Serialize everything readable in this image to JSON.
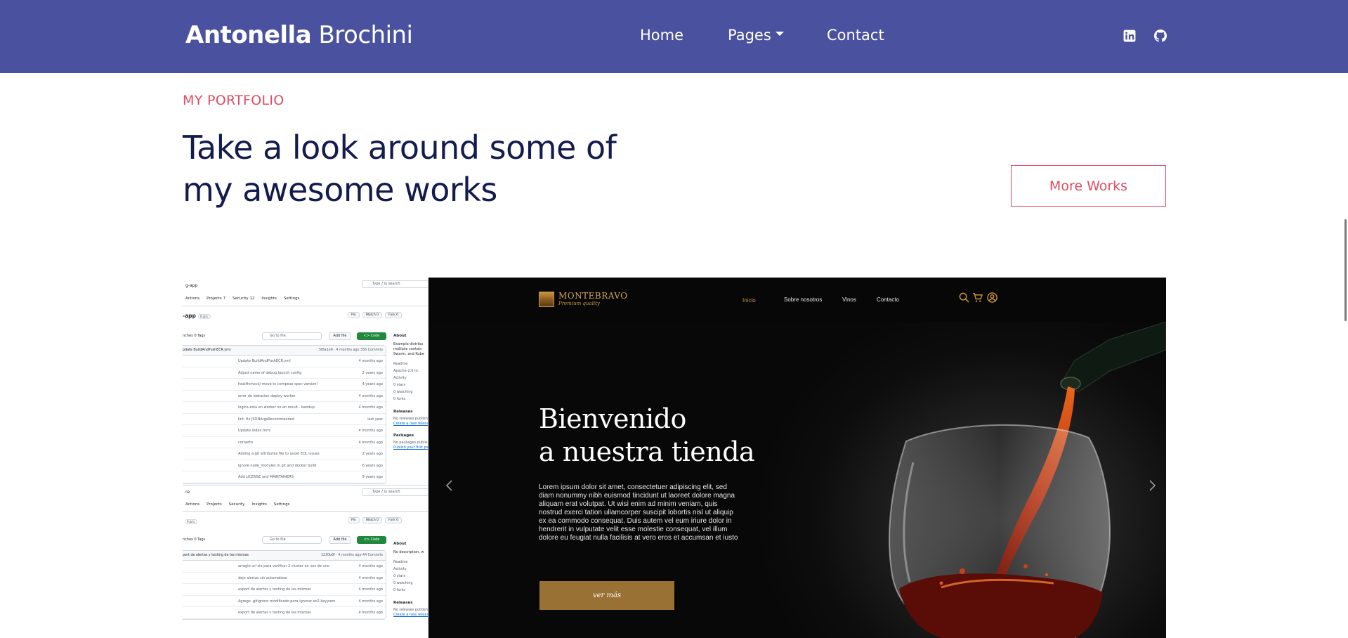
{
  "navbar": {
    "brand_bold": "Antonella",
    "brand_light": " Brochini",
    "links": {
      "home": "Home",
      "pages": "Pages",
      "contact": "Contact"
    },
    "social": [
      "linkedin-icon",
      "github-icon"
    ],
    "bg_color": "#4a52a0"
  },
  "portfolio": {
    "eyebrow": "MY PORTFOLIO",
    "heading": "Take a look around some of my awesome works",
    "more_button": "More Works",
    "accent_color": "#e24b62",
    "heading_color": "#141b4d"
  },
  "github_preview": {
    "top_label": "g-app",
    "search": "Type / to search",
    "tabs": [
      "Actions",
      "Projects 7",
      "Security 12",
      "Insights",
      "Settings"
    ],
    "repo_name": "-app",
    "visibility": "Public",
    "actions": [
      "Pin",
      "Watch 0",
      "Fork 0"
    ],
    "branches": "nches   0 Tags",
    "goto": "Go to file",
    "add_file": "Add file",
    "code": "<> Code",
    "commit_head": "pdate BuildAndPushECR.yml",
    "commit_meta": "5f8a1e8 · 4 months ago   356 Commits",
    "rows": [
      {
        "msg": "Update BuildAndPushECR.yml",
        "when": "4 months ago"
      },
      {
        "msg": "Adjust name of debug launch config",
        "when": "2 years ago"
      },
      {
        "msg": "healthcheck/ move to compose spec version!",
        "when": "4 years ago"
      },
      {
        "msg": "error de idetacion deploy worker",
        "when": "4 months ago"
      },
      {
        "msg": "logica esta en worker no en result - bandup",
        "when": "4 months ago"
      },
      {
        "msg": "lint: fix JSONArgsRecommended",
        "when": "last year"
      },
      {
        "msg": "Update index.html",
        "when": "4 months ago"
      },
      {
        "msg": "cornerto",
        "when": "4 months ago"
      },
      {
        "msg": "Adding a git attributes file to avoid EOL issues",
        "when": "2 years ago"
      },
      {
        "msg": "ignore node_modules in git and docker build",
        "when": "6 years ago"
      },
      {
        "msg": "Add LICENSE and MAINTAINERS",
        "when": "9 years ago"
      }
    ],
    "about": {
      "title": "About",
      "desc": "Example distribu multiple contain Swarm, and Kube",
      "items": [
        "Readme",
        "Apache-2.0 lic",
        "Activity",
        "0 stars",
        "0 watching",
        "0 forks"
      ],
      "releases": "Releases",
      "releases_note": "No releases published",
      "releases_link": "Create a new release",
      "packages": "Packages",
      "packages_note": "No packages published",
      "packages_link": "Publish your first pack"
    },
    "repo2": {
      "top_label": "re",
      "tabs": [
        "Actions",
        "Projects",
        "Security",
        "Insights",
        "Settings"
      ],
      "visibility": "Public",
      "branches": "nches   0 Tags",
      "commit_head": "port de alertas y testing de las mismas",
      "commit_meta": "1230b8f · 4 months ago   44 Commits",
      "rows": [
        {
          "msg": "arreglo url slo para verificar 2 cluster en vez de uno",
          "when": "4 months ago"
        },
        {
          "msg": "dejo alertas sin automatizar",
          "when": "4 months ago"
        },
        {
          "msg": "export de alertas y testing de las mismas",
          "when": "4 months ago"
        },
        {
          "msg": "Agrego .gitignore modificado para ignorar ec2-key.pem",
          "when": "4 months ago"
        },
        {
          "msg": "export de alertas y testing de las mismas",
          "when": "4 months ago"
        }
      ],
      "about": {
        "title": "About",
        "desc": "No description, w",
        "items": [
          "Readme",
          "Activity",
          "0 stars",
          "0 watching",
          "0 forks"
        ],
        "releases": "Releases",
        "releases_note": "No releases published",
        "releases_link": "Create a new release"
      }
    }
  },
  "wine_preview": {
    "logo": "MONTEBRAVO",
    "tagline": "Premium quality",
    "nav": [
      "Inicio",
      "Sobre nosotros",
      "Vinos",
      "Contacto"
    ],
    "title_line1": "Bienvenido",
    "title_line2": "a nuestra tienda",
    "body": "Lorem ipsum dolor sit amet, consectetuer adipiscing elit, sed diam nonummy nibh euismod tincidunt ut laoreet dolore magna aliquam erat volutpat. Ut wisi enim ad minim veniam, quis nostrud exerci tation ullamcorper suscipit lobortis nisl ut aliquip ex ea commodo consequat. Duis autem vel eum iriure dolor in hendrerit in vulputate velit esse molestie consequat, vel illum dolore eu feugiat nulla facilisis at vero eros et accumsan et iusto",
    "button": "ver más",
    "gold_color": "#9a7135"
  },
  "carousel": {
    "prev_icon": "chevron-left-icon",
    "next_icon": "chevron-right-icon"
  }
}
